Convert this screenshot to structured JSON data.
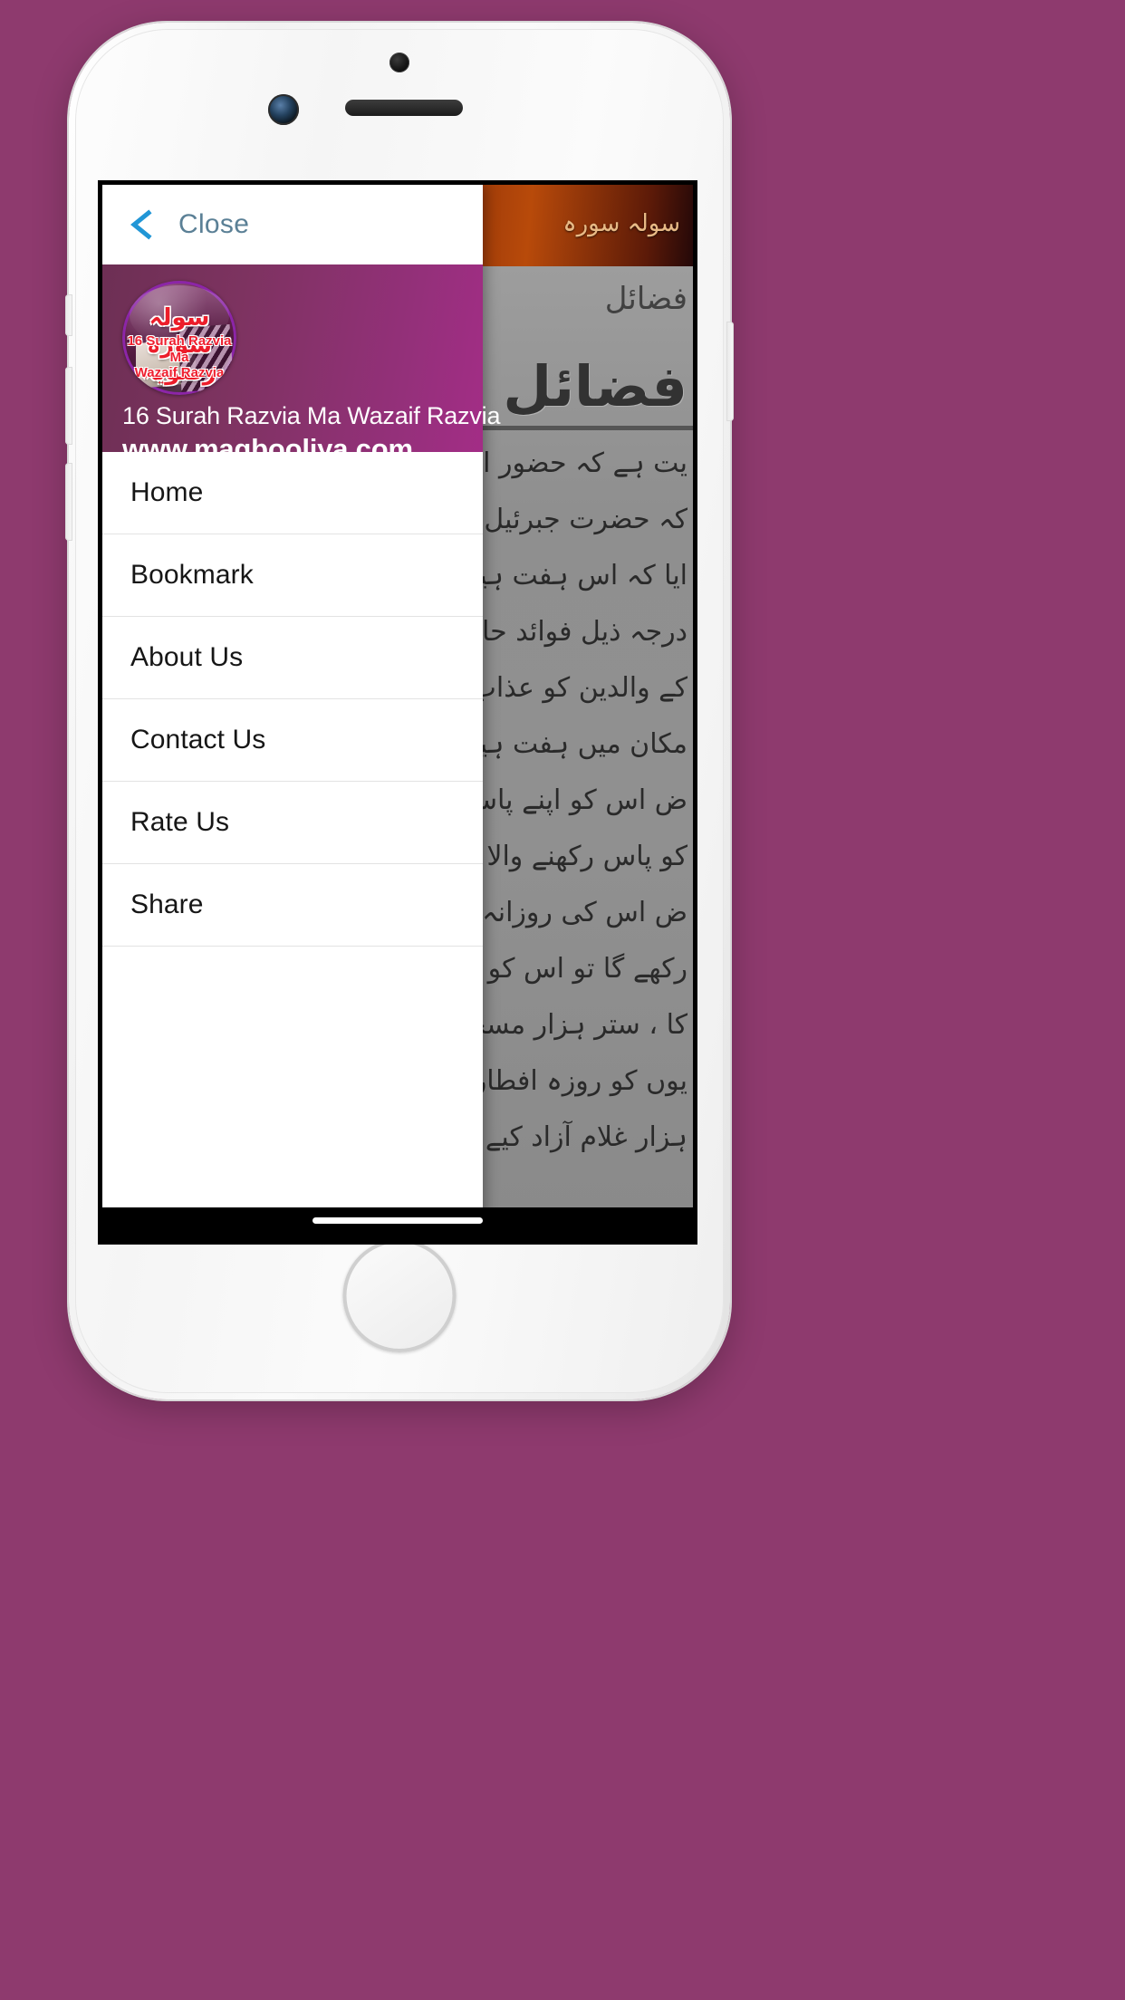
{
  "device": {
    "name": "iphone-mockup",
    "camera_icon": "camera-icon",
    "speaker_icon": "speaker-grill-icon",
    "home_button_icon": "home-button-icon"
  },
  "page_background_color": "#8e3a6e",
  "drawer": {
    "close_bar": {
      "back_icon": "back-chevron-icon",
      "label": "Close",
      "label_color": "#5b8096"
    },
    "header": {
      "app_title": "16 Surah Razvia Ma Wazaif Razvia",
      "website": "www.maqbooliya.com",
      "background_color": "#8a3270",
      "logo": {
        "icon": "app-logo-icon",
        "script_text": "سولہ سورہ رضویہ",
        "caption_line1": "16 Surah Razvia",
        "caption_line2": "Ma",
        "caption_line3": "Wazaif Razvia",
        "caption_color": "#ef2030"
      }
    },
    "menu_items": [
      {
        "label": "Home"
      },
      {
        "label": "Bookmark"
      },
      {
        "label": "About Us"
      },
      {
        "label": "Contact Us"
      },
      {
        "label": "Rate Us"
      },
      {
        "label": "Share"
      }
    ]
  },
  "app_content": {
    "banner": {
      "title": "سولہ سورہ",
      "background_color": "#7a2508"
    },
    "scanned_page": {
      "subheading": "فضائل",
      "heading": "فضائل",
      "body_lines": [
        "یت ہے کہ حضور انور صلی",
        "کہ حضرت جبرئیل علیہ السلام",
        "ایا کہ اس ہفت ہیکل کو",
        "درجہ ذیل فوائد حاصل ہو",
        "کے والدین کو عذاب",
        "مکان میں ہفت ہیکل",
        "ض اس کو اپنے پاس",
        "کو پاس رکھنے والا جمیع",
        "ض اس کی روزانہ تلاوت",
        "رکھے گا تو اس کو کُل",
        "کا ، ستر ہزار مسجدیں تعمیر",
        "یوں کو روزہ افطار کرا",
        "ہزار غلام آزاد کیے ، ستر ہزار"
      ]
    }
  }
}
